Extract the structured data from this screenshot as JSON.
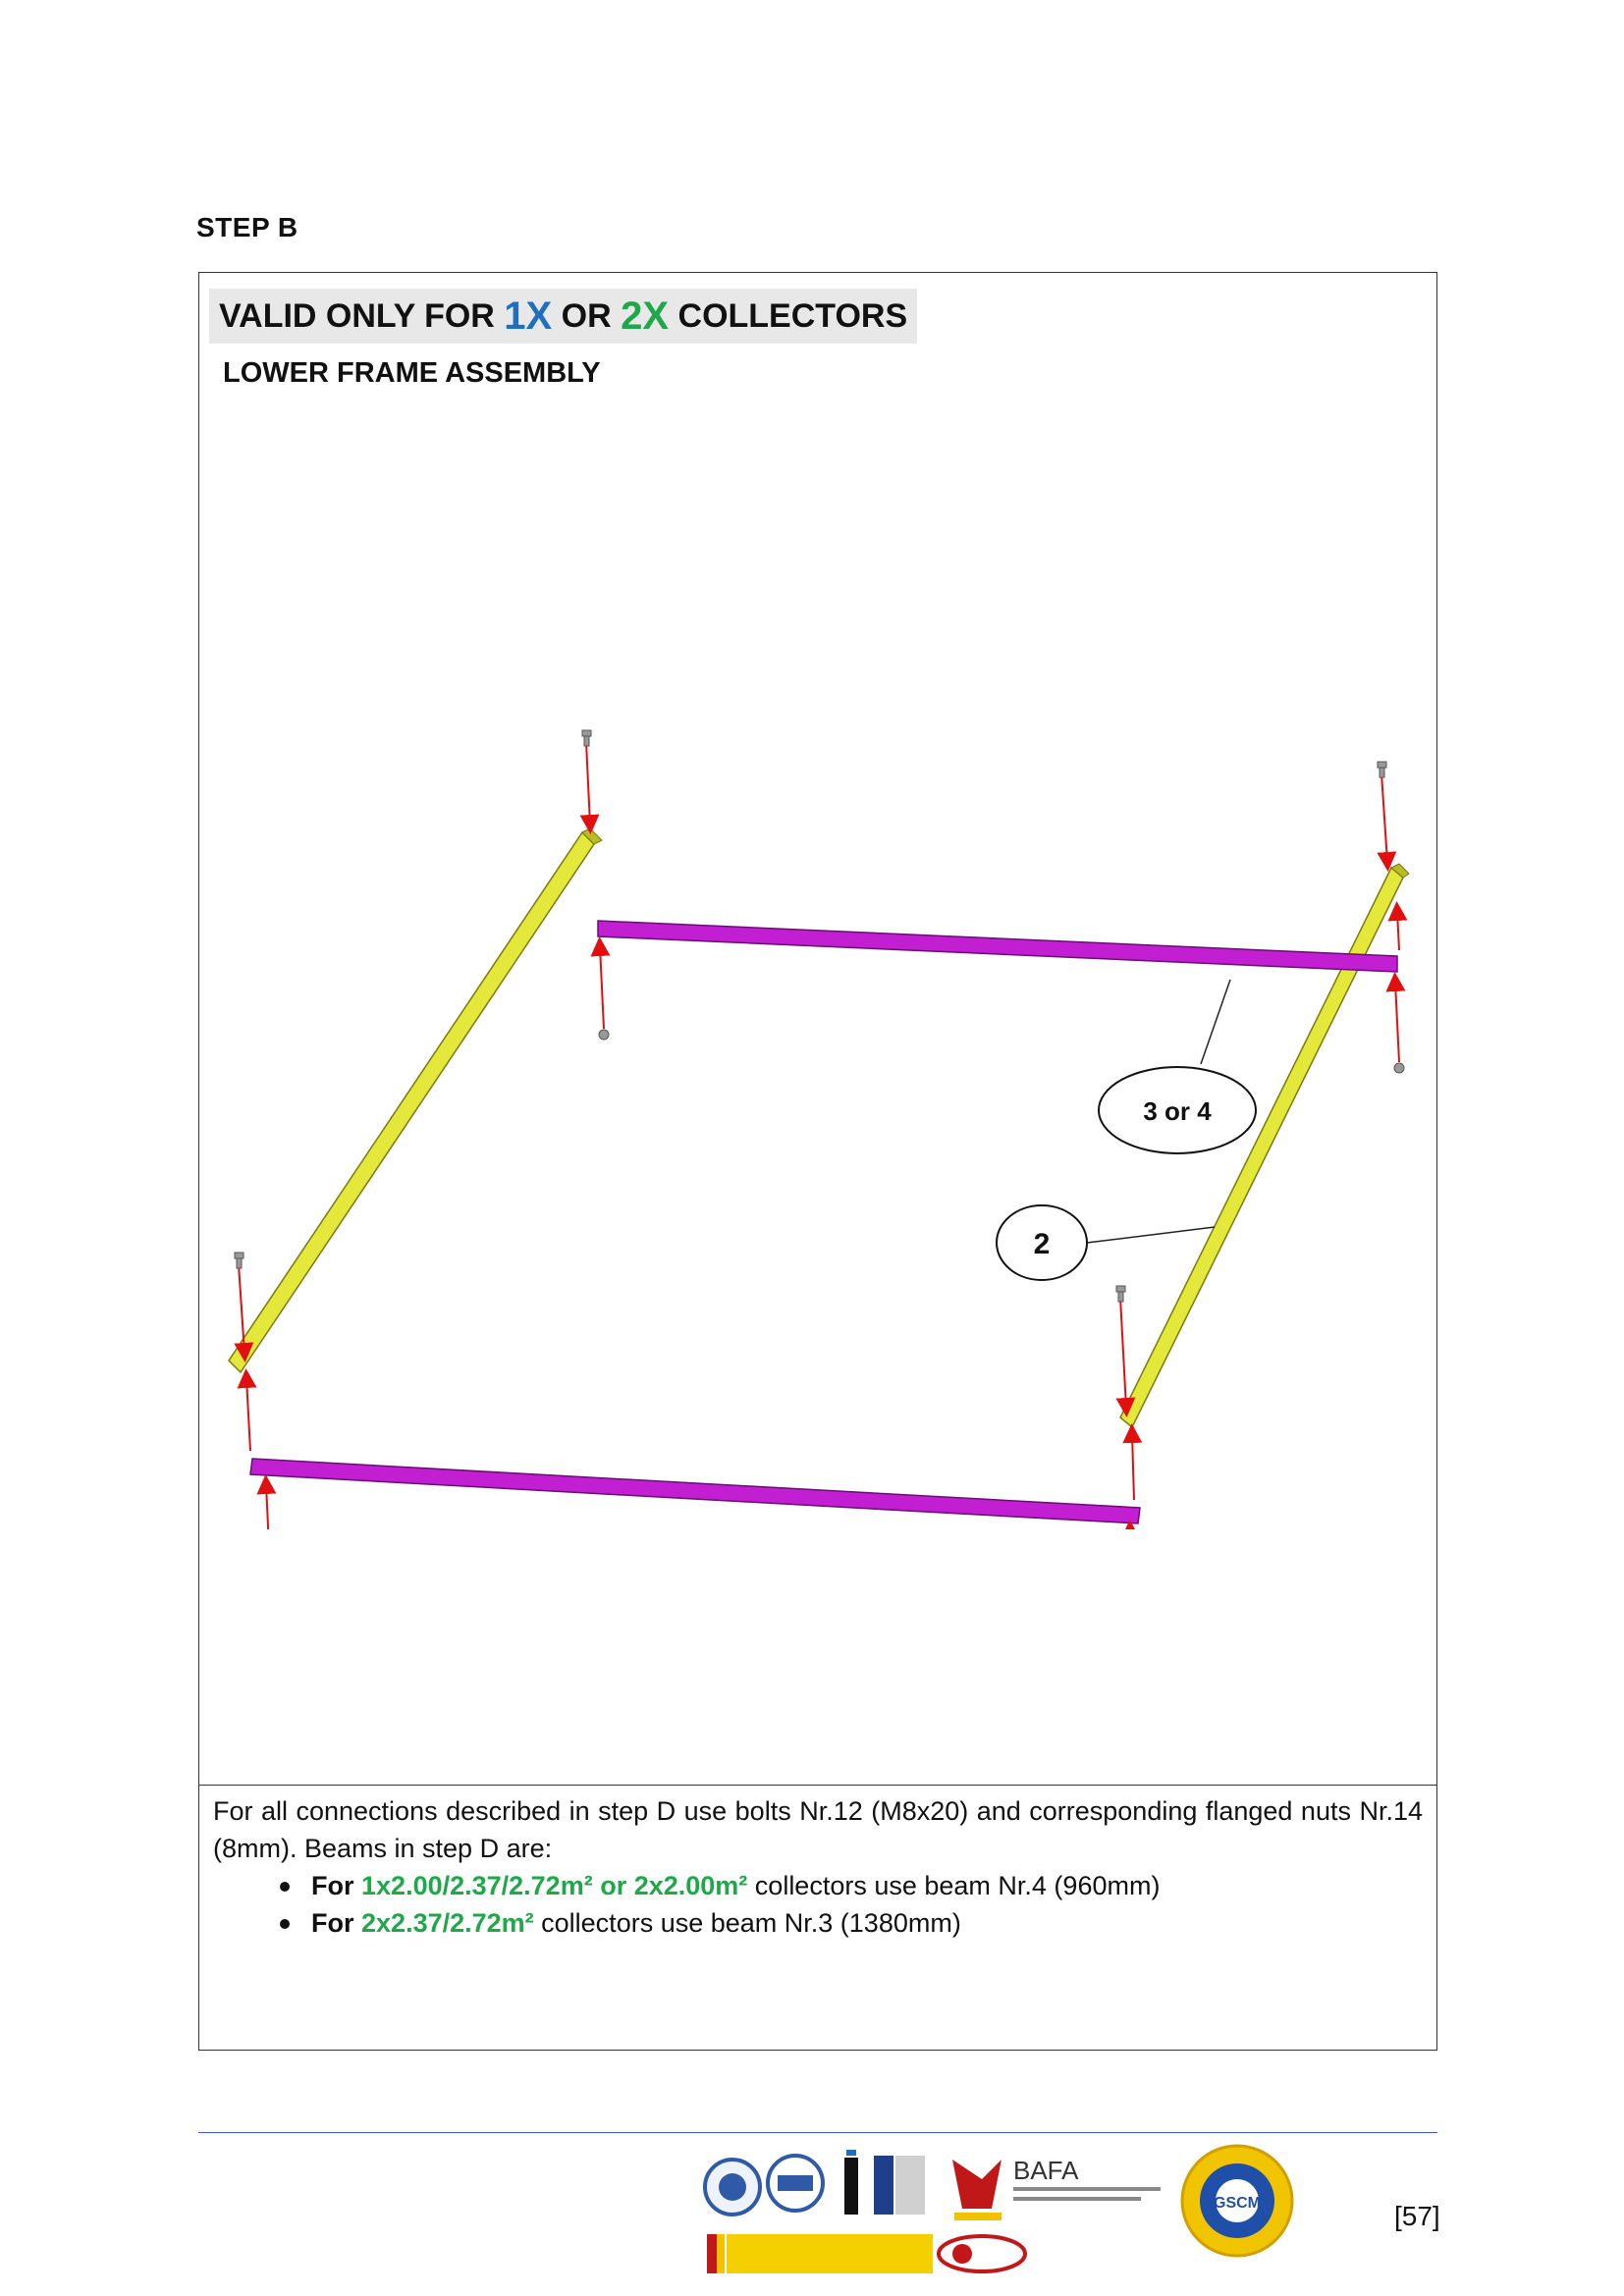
{
  "step_title": "STEP B",
  "banner": {
    "prefix": "VALID ONLY FOR ",
    "opt1": "1X",
    "mid": " OR ",
    "opt2": "2X",
    "suffix": " COLLECTORS"
  },
  "subtitle": "LOWER FRAME ASSEMBLY",
  "callouts": {
    "beam_cross": "3 or 4",
    "beam_side": "2"
  },
  "colors": {
    "side_beam": "#e4e83a",
    "cross_beam": "#c21fd2",
    "arrow": "#e01010",
    "accent_blue": "#1f6fc1",
    "accent_green": "#1fa84a"
  },
  "instructions": {
    "paragraph": "For all connections described in step D use bolts Nr.12 (M8x20) and corresponding flanged nuts Nr.14 (8mm). Beams in step D are:",
    "items": [
      {
        "for": "For",
        "spec": "1x2.00/2.37/2.72m² or 2x2.00m²",
        "rest": " collectors use beam Nr.4 (960mm)"
      },
      {
        "for": "For",
        "spec": "2x2.37/2.72m²",
        "rest": " collectors use beam Nr.3 (1380mm)"
      }
    ]
  },
  "footer": {
    "logo_bafa": "BAFA",
    "logo_gscm": "GSCM",
    "page_number": "[57]"
  }
}
